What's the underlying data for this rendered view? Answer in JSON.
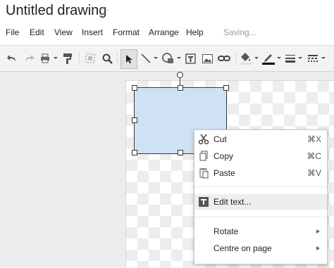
{
  "app": {
    "title": "Untitled drawing",
    "status": "Saving..."
  },
  "menubar": {
    "items": [
      "File",
      "Edit",
      "View",
      "Insert",
      "Format",
      "Arrange",
      "Help"
    ]
  },
  "toolbar": {
    "icons": [
      "undo-icon",
      "redo-icon",
      "print-icon",
      "paint-format-icon",
      "zoom-fit-icon",
      "zoom-icon",
      "select-icon",
      "line-icon",
      "shape-icon",
      "text-box-icon",
      "image-icon",
      "link-icon",
      "fill-color-icon",
      "line-color-icon",
      "line-weight-icon",
      "line-dash-icon"
    ]
  },
  "colors": {
    "shape_fill": "#cfe2f3",
    "menu_highlight": "#eeeeee",
    "line_color_swatch": "#000000"
  },
  "context_menu": {
    "items": [
      {
        "label": "Cut",
        "shortcut": "⌘X",
        "icon": "scissors-icon"
      },
      {
        "label": "Copy",
        "shortcut": "⌘C",
        "icon": "copy-icon"
      },
      {
        "label": "Paste",
        "shortcut": "⌘V",
        "icon": "paste-icon"
      },
      {
        "label": "Edit text...",
        "icon": "text-box-icon",
        "highlighted": true
      },
      {
        "label": "Rotate",
        "submenu": true
      },
      {
        "label": "Centre on page",
        "submenu": true
      }
    ]
  }
}
